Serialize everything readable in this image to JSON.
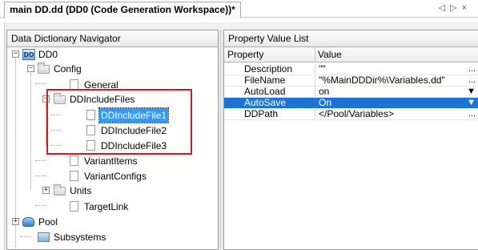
{
  "tab": {
    "title": "main DD.dd (DD0 (Code Generation Workspace))*",
    "close_glyph": "×"
  },
  "tabnav": {
    "left": "◁",
    "right": "▷",
    "close": "×"
  },
  "navigator": {
    "title": "Data Dictionary Navigator",
    "tree": {
      "root": {
        "label": "DD0",
        "icon": "data-dictionary-icon",
        "expanded": true
      },
      "config": {
        "label": "Config",
        "icon": "folder-icon",
        "expanded": true
      },
      "general": {
        "label": "General",
        "icon": "page-icon"
      },
      "ddincludefiles": {
        "label": "DDIncludeFiles",
        "icon": "folder-icon",
        "expanded": true
      },
      "include1": {
        "label": "DDIncludeFile1",
        "icon": "page-icon",
        "selected": true
      },
      "include2": {
        "label": "DDIncludeFile2",
        "icon": "page-icon"
      },
      "include3": {
        "label": "DDIncludeFile3",
        "icon": "page-icon"
      },
      "variantitems": {
        "label": "VariantItems",
        "icon": "page-icon"
      },
      "variantconfigs": {
        "label": "VariantConfigs",
        "icon": "page-icon"
      },
      "units": {
        "label": "Units",
        "icon": "folder-icon",
        "expanded": false
      },
      "targetlink": {
        "label": "TargetLink",
        "icon": "page-icon"
      },
      "pool": {
        "label": "Pool",
        "icon": "pool-icon",
        "expanded": false
      },
      "subsystems": {
        "label": "Subsystems",
        "icon": "subsystems-icon"
      }
    },
    "expander_expanded": "−",
    "expander_collapsed": "+"
  },
  "properties": {
    "title": "Property Value List",
    "col_property": "Property",
    "col_value": "Value",
    "rows": [
      {
        "name": "Description",
        "value": "\"\"",
        "action": "..."
      },
      {
        "name": "FileName",
        "value": "\"%MainDDDir%\\Variables.dd\"",
        "action": "..."
      },
      {
        "name": "AutoLoad",
        "value": "on",
        "action": "▼"
      },
      {
        "name": "AutoSave",
        "value": "On",
        "action": "▼",
        "selected": true
      },
      {
        "name": "DDPath",
        "value": "</Pool/Variables>",
        "action": "..."
      }
    ]
  },
  "colors": {
    "selection": "#3399ff",
    "row_selection": "#1e74d6",
    "highlight_box": "#e0141c"
  }
}
